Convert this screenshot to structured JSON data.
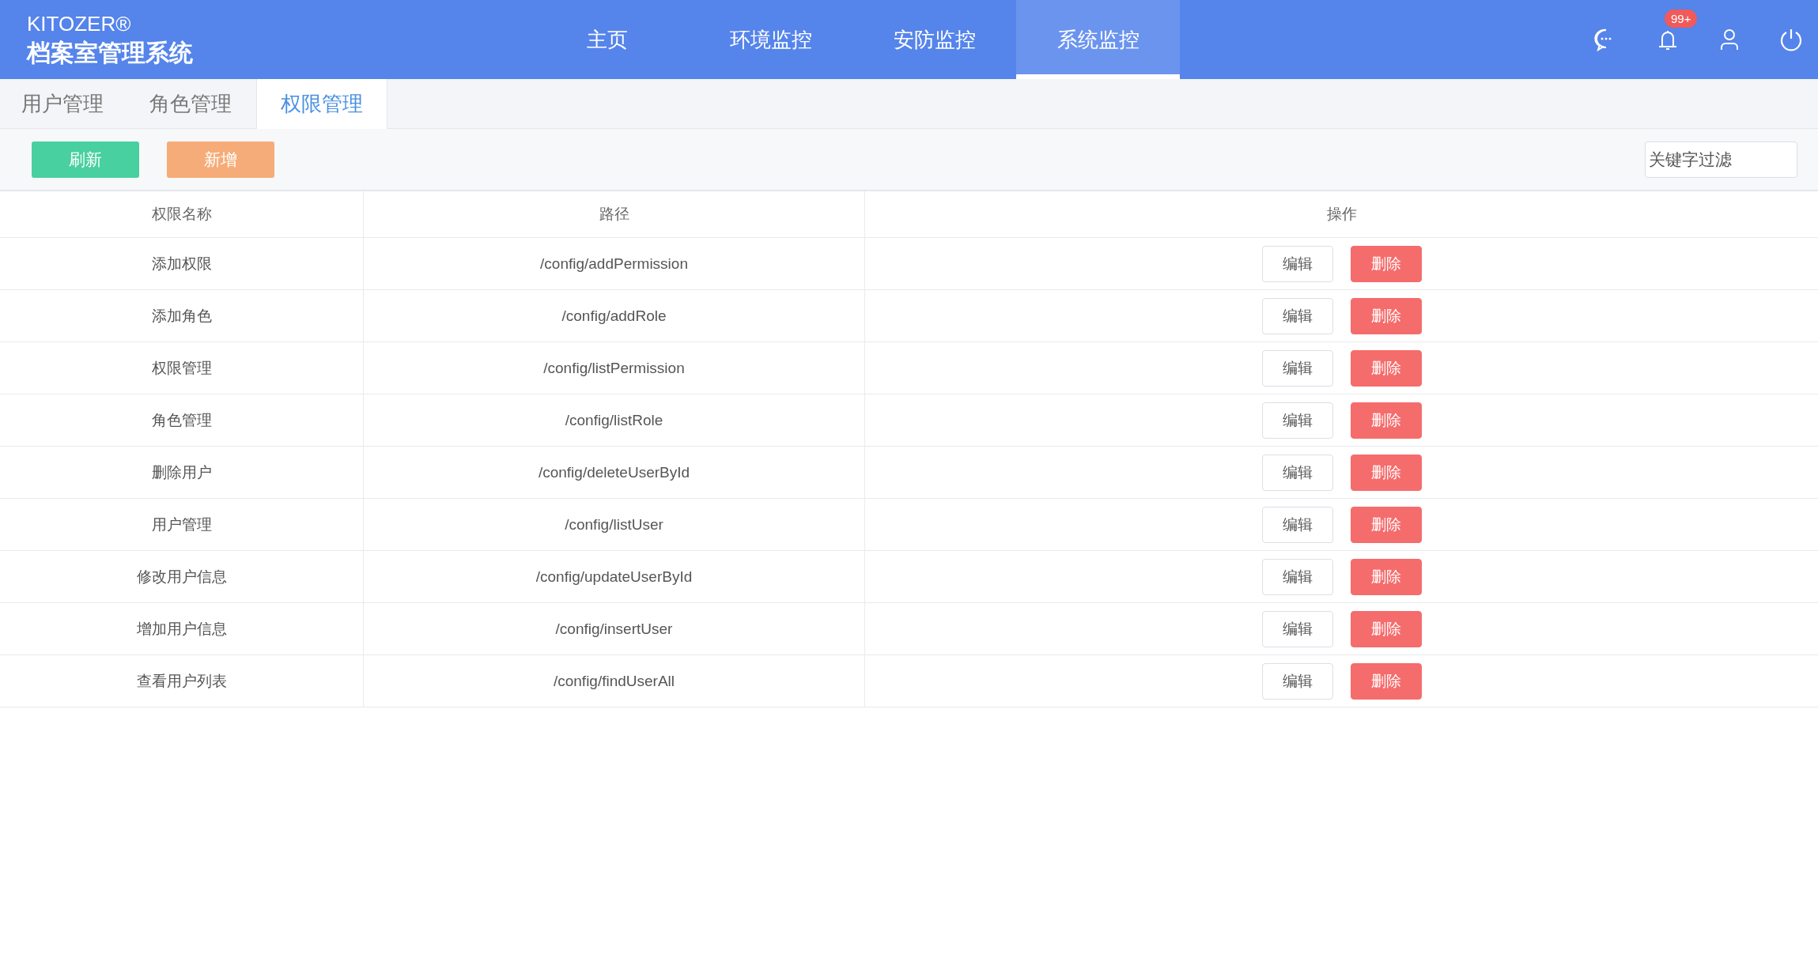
{
  "brand": {
    "logo": "KITOZER®",
    "title": "档案室管理系统"
  },
  "nav": [
    {
      "label": "主页",
      "selected": false
    },
    {
      "label": "环境监控",
      "selected": false
    },
    {
      "label": "安防监控",
      "selected": false
    },
    {
      "label": "系统监控",
      "selected": true
    }
  ],
  "header_icons": [
    {
      "kind": "chat"
    },
    {
      "kind": "bell",
      "badge": "99+"
    },
    {
      "kind": "user"
    },
    {
      "kind": "power"
    }
  ],
  "tabs": [
    {
      "label": "用户管理",
      "selected": false
    },
    {
      "label": "角色管理",
      "selected": false
    },
    {
      "label": "权限管理",
      "selected": true
    }
  ],
  "toolbar": {
    "buttons": [
      {
        "label": "刷新",
        "kind": "refresh"
      },
      {
        "label": "新增",
        "kind": "add"
      }
    ],
    "search": {
      "placeholder": "关键字过滤"
    }
  },
  "table": {
    "columns": [
      "权限名称",
      "路径",
      "操作"
    ],
    "rows": [
      {
        "name": "添加权限",
        "path": "/config/addPermission",
        "actions": [
          "编辑",
          "删除"
        ]
      },
      {
        "name": "添加角色",
        "path": "/config/addRole",
        "actions": [
          "编辑",
          "删除"
        ]
      },
      {
        "name": "权限管理",
        "path": "/config/listPermission",
        "actions": [
          "编辑",
          "删除"
        ]
      },
      {
        "name": "角色管理",
        "path": "/config/listRole",
        "actions": [
          "编辑",
          "删除"
        ]
      },
      {
        "name": "删除用户",
        "path": "/config/deleteUserById",
        "actions": [
          "编辑",
          "删除"
        ]
      },
      {
        "name": "用户管理",
        "path": "/config/listUser",
        "actions": [
          "编辑",
          "删除"
        ]
      },
      {
        "name": "修改用户信息",
        "path": "/config/updateUserById",
        "actions": [
          "编辑",
          "删除"
        ]
      },
      {
        "name": "增加用户信息",
        "path": "/config/insertUser",
        "actions": [
          "编辑",
          "删除"
        ]
      },
      {
        "name": "查看用户列表",
        "path": "/config/findUserAll",
        "actions": [
          "编辑",
          "删除"
        ]
      }
    ]
  }
}
